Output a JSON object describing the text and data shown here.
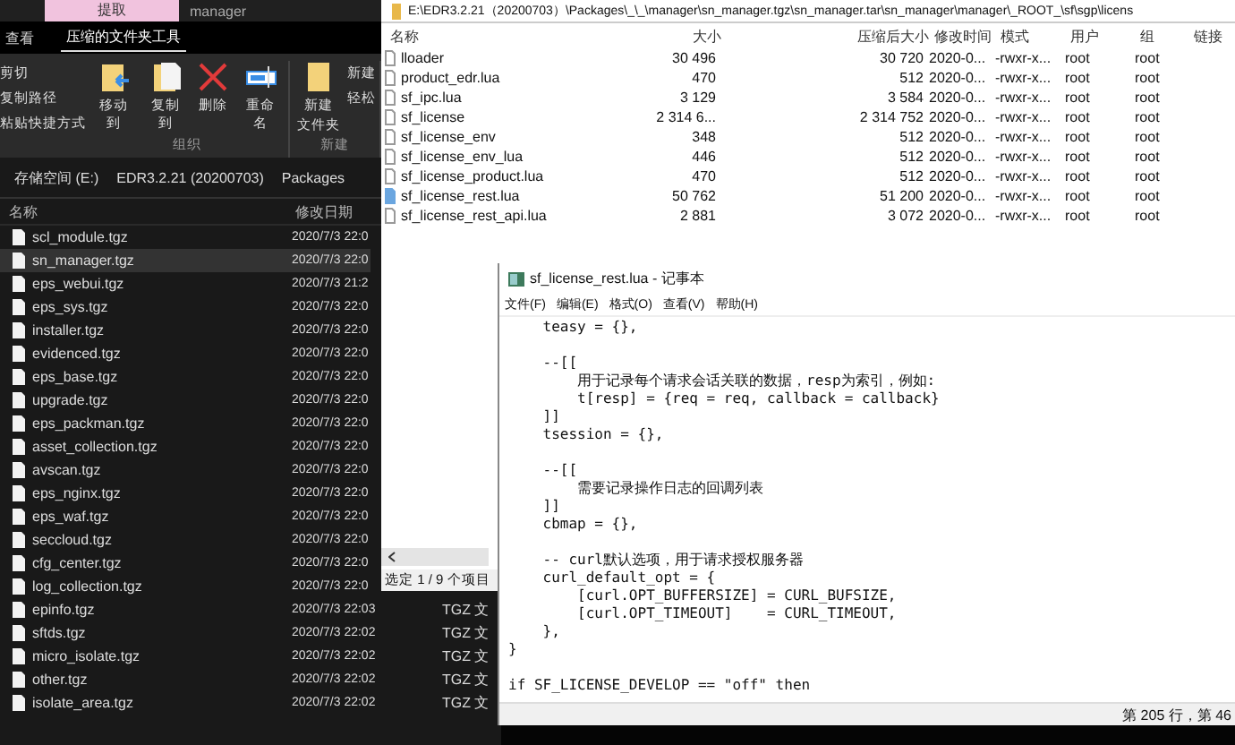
{
  "explorer": {
    "context_tab": {
      "label": "提取"
    },
    "title": "manager",
    "ribbon_tabs": [
      {
        "label": "查看",
        "selected": false
      },
      {
        "label": "压缩的文件夹工具",
        "selected": true
      }
    ],
    "clipboard_items": [
      "剪切",
      "复制路径",
      "粘贴快捷方式"
    ],
    "organize_buttons": [
      {
        "kind": "move",
        "label": "移动到"
      },
      {
        "kind": "copy",
        "label": "复制到"
      },
      {
        "kind": "delete",
        "label": "删除"
      },
      {
        "kind": "rename",
        "label": "重命名"
      }
    ],
    "organize_group": "组织",
    "new_folder": [
      "新建",
      "文件夹"
    ],
    "new_items": [
      "新建",
      "轻松"
    ],
    "new_group": "新建",
    "breadcrumb": [
      "存储空间 (E:)",
      "EDR3.2.21 (20200703)",
      "Packages"
    ],
    "columns": [
      "名称",
      "修改日期"
    ],
    "rows": [
      {
        "name": "scl_module.tgz",
        "modified": "2020/7/3 22:0",
        "selected": false
      },
      {
        "name": "sn_manager.tgz",
        "modified": "2020/7/3 22:0",
        "selected": true
      },
      {
        "name": "eps_webui.tgz",
        "modified": "2020/7/3 21:2",
        "selected": false
      },
      {
        "name": "eps_sys.tgz",
        "modified": "2020/7/3 22:0",
        "selected": false
      },
      {
        "name": "installer.tgz",
        "modified": "2020/7/3 22:0",
        "selected": false
      },
      {
        "name": "evidenced.tgz",
        "modified": "2020/7/3 22:0",
        "selected": false
      },
      {
        "name": "eps_base.tgz",
        "modified": "2020/7/3 22:0",
        "selected": false
      },
      {
        "name": "upgrade.tgz",
        "modified": "2020/7/3 22:0",
        "selected": false
      },
      {
        "name": "eps_packman.tgz",
        "modified": "2020/7/3 22:0",
        "selected": false
      },
      {
        "name": "asset_collection.tgz",
        "modified": "2020/7/3 22:0",
        "selected": false
      },
      {
        "name": "avscan.tgz",
        "modified": "2020/7/3 22:0",
        "selected": false
      },
      {
        "name": "eps_nginx.tgz",
        "modified": "2020/7/3 22:0",
        "selected": false
      },
      {
        "name": "eps_waf.tgz",
        "modified": "2020/7/3 22:0",
        "selected": false
      },
      {
        "name": "seccloud.tgz",
        "modified": "2020/7/3 22:0",
        "selected": false
      },
      {
        "name": "cfg_center.tgz",
        "modified": "2020/7/3 22:0",
        "selected": false
      },
      {
        "name": "log_collection.tgz",
        "modified": "2020/7/3 22:0",
        "selected": false
      },
      {
        "name": "epinfo.tgz",
        "modified": "2020/7/3 22:03",
        "type": "TGZ 文",
        "selected": false
      },
      {
        "name": "sftds.tgz",
        "modified": "2020/7/3 22:02",
        "type": "TGZ 文",
        "selected": false
      },
      {
        "name": "micro_isolate.tgz",
        "modified": "2020/7/3 22:02",
        "type": "TGZ 文",
        "selected": false
      },
      {
        "name": "other.tgz",
        "modified": "2020/7/3 22:02",
        "type": "TGZ 文",
        "selected": false
      },
      {
        "name": "isolate_area.tgz",
        "modified": "2020/7/3 22:02",
        "type": "TGZ 文",
        "selected": false
      }
    ]
  },
  "archive": {
    "path": "E:\\EDR3.2.21（20200703）\\Packages\\_\\_\\manager\\sn_manager.tgz\\sn_manager.tar\\sn_manager\\manager\\_ROOT_\\sf\\sgp\\licens",
    "columns": [
      "名称",
      "大小",
      "压缩后大小",
      "修改时间",
      "模式",
      "用户",
      "组",
      "链接"
    ],
    "rows": [
      {
        "cells": [
          "lloader",
          "30 496",
          "30 720",
          "2020-0...",
          "-rwxr-x...",
          "root",
          "root"
        ],
        "selected": false
      },
      {
        "cells": [
          "product_edr.lua",
          "470",
          "512",
          "2020-0...",
          "-rwxr-x...",
          "root",
          "root"
        ],
        "selected": false
      },
      {
        "cells": [
          "sf_ipc.lua",
          "3 129",
          "3 584",
          "2020-0...",
          "-rwxr-x...",
          "root",
          "root"
        ],
        "selected": false
      },
      {
        "cells": [
          "sf_license",
          "2 314 6...",
          "2 314 752",
          "2020-0...",
          "-rwxr-x...",
          "root",
          "root"
        ],
        "selected": false
      },
      {
        "cells": [
          "sf_license_env",
          "348",
          "512",
          "2020-0...",
          "-rwxr-x...",
          "root",
          "root"
        ],
        "selected": false
      },
      {
        "cells": [
          "sf_license_env_lua",
          "446",
          "512",
          "2020-0...",
          "-rwxr-x...",
          "root",
          "root"
        ],
        "selected": false
      },
      {
        "cells": [
          "sf_license_product.lua",
          "470",
          "512",
          "2020-0...",
          "-rwxr-x...",
          "root",
          "root"
        ],
        "selected": false
      },
      {
        "cells": [
          "sf_license_rest.lua",
          "50 762",
          "51 200",
          "2020-0...",
          "-rwxr-x...",
          "root",
          "root"
        ],
        "selected": true
      },
      {
        "cells": [
          "sf_license_rest_api.lua",
          "2 881",
          "3 072",
          "2020-0...",
          "-rwxr-x...",
          "root",
          "root"
        ],
        "selected": false
      }
    ],
    "status": "选定 1 / 9 个项目"
  },
  "notepad": {
    "title": "sf_license_rest.lua - 记事本",
    "menu": [
      "文件(F)",
      "编辑(E)",
      "格式(O)",
      "查看(V)",
      "帮助(H)"
    ],
    "blocks": [
      [
        "    teasy = {},"
      ],
      [
        "    --[[",
        "        用于记录每个请求会话关联的数据，resp为索引，例如:",
        "        t[resp] = {req = req, callback = callback}",
        "    ]]",
        "    tsession = {},"
      ],
      [
        "    --[[",
        "        需要记录操作日志的回调列表",
        "    ]]",
        "    cbmap = {},"
      ],
      [
        "    -- curl默认选项，用于请求授权服务器",
        "    curl_default_opt = {",
        "        [curl.OPT_BUFFERSIZE] = CURL_BUFSIZE,",
        "        [curl.OPT_TIMEOUT]    = CURL_TIMEOUT,",
        "    },",
        "}"
      ],
      [
        "if SF_LICENSE_DEVELOP == \"off\" then"
      ]
    ],
    "status": "第 205 行，第 46"
  }
}
